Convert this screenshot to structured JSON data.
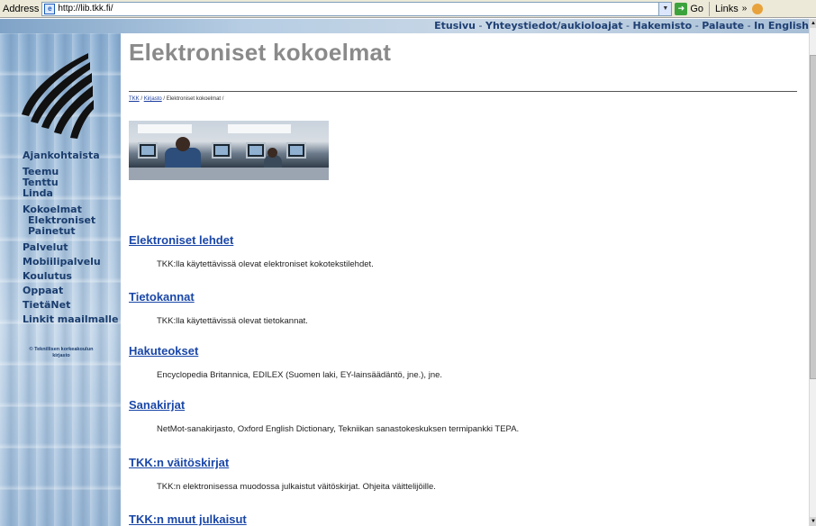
{
  "browser": {
    "address_label": "Address",
    "url": "http://lib.tkk.fi/",
    "go_label": "Go",
    "links_label": "Links"
  },
  "topnav": [
    "Etusivu",
    "Yhteystiedot/aukioloajat",
    "Hakemisto",
    "Palaute",
    "In English"
  ],
  "sidebar": {
    "items": [
      {
        "label": "Ajankohtaista",
        "sub": false
      },
      {
        "label": "Teemu",
        "sub": false
      },
      {
        "label": "Tenttu",
        "sub": false
      },
      {
        "label": "Linda",
        "sub": false
      },
      {
        "label": "Kokoelmat",
        "sub": false
      },
      {
        "label": "Elektroniset",
        "sub": true
      },
      {
        "label": "Painetut",
        "sub": true
      },
      {
        "label": "Palvelut",
        "sub": false
      },
      {
        "label": "Mobiilipalvelu",
        "sub": false
      },
      {
        "label": "Koulutus",
        "sub": false
      },
      {
        "label": "Oppaat",
        "sub": false
      },
      {
        "label": "TietäNet",
        "sub": false
      },
      {
        "label": "Linkit maailmalle",
        "sub": false
      }
    ],
    "copyright_line1": "© Teknillisen korkeakoulun",
    "copyright_line2": "kirjasto"
  },
  "main": {
    "title": "Elektroniset kokoelmat",
    "breadcrumb": {
      "link1": "TKK",
      "link2": "Kirjasto",
      "current": "Elektroniset kokoelmat /"
    },
    "sections": [
      {
        "heading": "Elektroniset lehdet",
        "text": "TKK:lla käytettävissä olevat elektroniset kokotekstilehdet."
      },
      {
        "heading": "Tietokannat",
        "text": "TKK:lla käytettävissä olevat tietokannat."
      },
      {
        "heading": "Hakuteokset",
        "text": "Encyclopedia Britannica, EDILEX (Suomen laki, EY-lainsäädäntö, jne.), jne."
      },
      {
        "heading": "Sanakirjat",
        "text": "NetMot-sanakirjasto, Oxford English Dictionary, Tekniikan sanastokeskuksen termipankki TEPA."
      },
      {
        "heading": "TKK:n väitöskirjat",
        "text": "TKK:n elektronisessa muodossa julkaistut väitöskirjat. Ohjeita väittelijöille."
      },
      {
        "heading": "TKK:n muut julkaisut",
        "text": ""
      }
    ]
  }
}
